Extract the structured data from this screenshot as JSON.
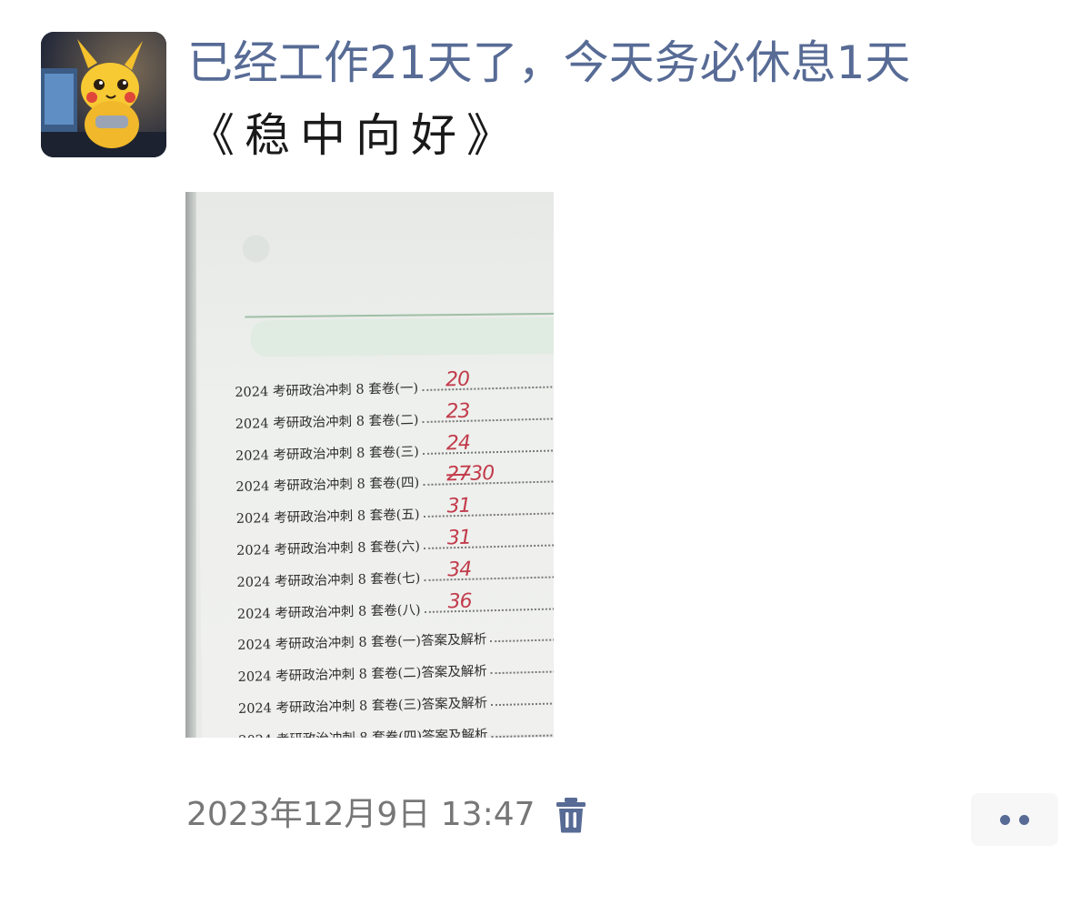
{
  "post": {
    "author": "已经工作21天了，今天务必休息1天",
    "text": "《稳中向好》",
    "timestamp": "2023年12月9日 13:47"
  },
  "photo": {
    "toc": [
      {
        "label": "2024 考研政治冲刺 8 套卷(一)",
        "score": "20"
      },
      {
        "label": "2024 考研政治冲刺 8 套卷(二)",
        "score": "23"
      },
      {
        "label": "2024 考研政治冲刺 8 套卷(三)",
        "score": "24"
      },
      {
        "label": "2024 考研政治冲刺 8 套卷(四)",
        "score_struck": "27",
        "score": "30"
      },
      {
        "label": "2024 考研政治冲刺 8 套卷(五)",
        "score": "31"
      },
      {
        "label": "2024 考研政治冲刺 8 套卷(六)",
        "score": "31"
      },
      {
        "label": "2024 考研政治冲刺 8 套卷(七)",
        "score": "34"
      },
      {
        "label": "2024 考研政治冲刺 8 套卷(八)",
        "score": "36"
      },
      {
        "label": "2024 考研政治冲刺 8 套卷(一)答案及解析"
      },
      {
        "label": "2024 考研政治冲刺 8 套卷(二)答案及解析"
      },
      {
        "label": "2024 考研政治冲刺 8 套卷(三)答案及解析"
      },
      {
        "label": "2024 考研政治冲刺 8 套卷(四)答案及解析"
      }
    ]
  },
  "icons": {
    "avatar": "pikachu-avatar",
    "delete": "trash-icon",
    "more": "more-dots-icon"
  },
  "colors": {
    "name_link": "#576b95",
    "handwriting": "#c23b4b",
    "timestamp": "#777777"
  }
}
